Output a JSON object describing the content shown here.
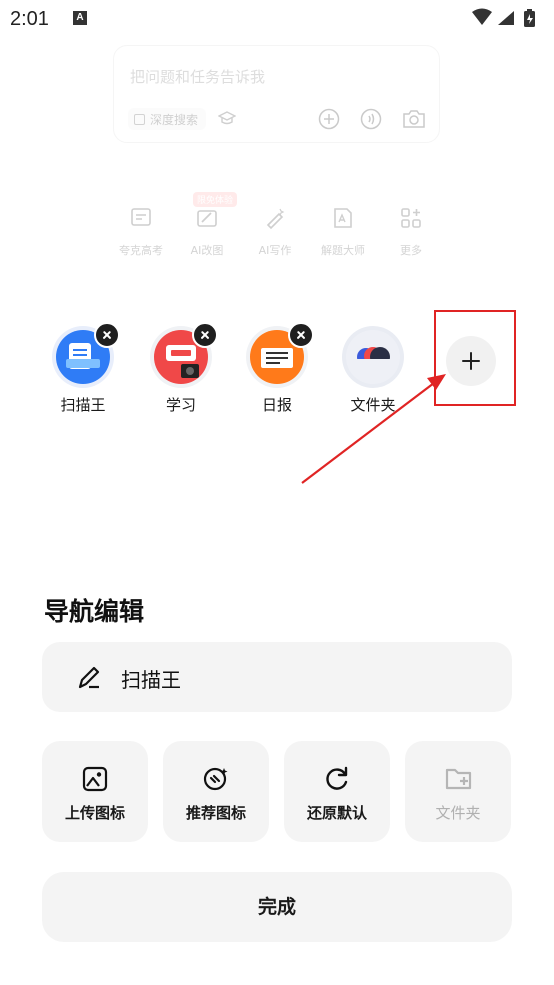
{
  "status_bar": {
    "time": "2:01",
    "notification_letter": "A"
  },
  "search": {
    "placeholder": "把问题和任务告诉我",
    "deep_search_label": "深度搜索"
  },
  "tools": [
    {
      "label": "夸克高考",
      "icon": "exam-icon"
    },
    {
      "label": "AI改图",
      "icon": "ai-edit-image-icon",
      "tag": "限免体验"
    },
    {
      "label": "AI写作",
      "icon": "ai-writing-icon"
    },
    {
      "label": "解题大师",
      "icon": "solve-problem-icon"
    },
    {
      "label": "更多",
      "icon": "more-apps-icon"
    }
  ],
  "nav_items": [
    {
      "label": "扫描王",
      "icon": "scanner-icon",
      "color": "#2f7cf6"
    },
    {
      "label": "学习",
      "icon": "study-photo-icon",
      "color": "#f04848"
    },
    {
      "label": "日报",
      "icon": "daily-news-icon",
      "color": "#ff7a1a"
    },
    {
      "label": "文件夹",
      "icon": "folder-icon",
      "color": "#3b5bdb"
    }
  ],
  "editor": {
    "title": "导航编辑",
    "current_name": "扫描王",
    "actions": [
      {
        "label": "上传图标",
        "icon": "upload-image-icon",
        "enabled": true
      },
      {
        "label": "推荐图标",
        "icon": "recommend-icon",
        "enabled": true
      },
      {
        "label": "还原默认",
        "icon": "restore-icon",
        "enabled": true
      },
      {
        "label": "文件夹",
        "icon": "add-folder-icon",
        "enabled": false
      }
    ],
    "done_label": "完成"
  },
  "colors": {
    "highlight": "#e02424",
    "card_bg": "#f4f4f4",
    "text": "#1a1a1a"
  }
}
